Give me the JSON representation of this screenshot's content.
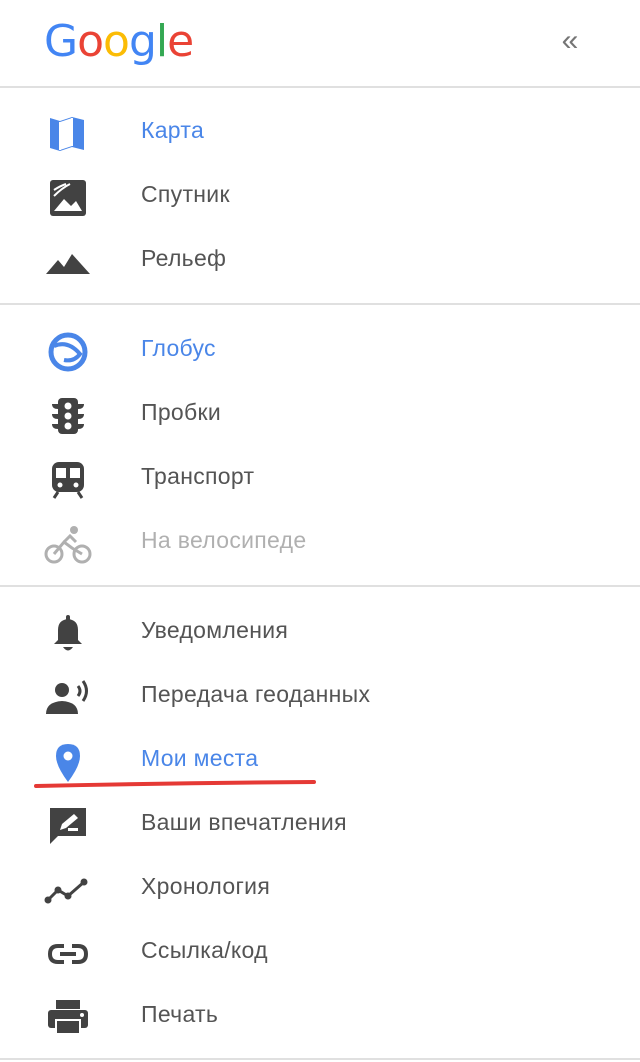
{
  "header": {
    "logo": {
      "letters": [
        {
          "ch": "G",
          "color": "#4285F4"
        },
        {
          "ch": "o",
          "color": "#EA4335"
        },
        {
          "ch": "o",
          "color": "#FBBC05"
        },
        {
          "ch": "g",
          "color": "#4285F4"
        },
        {
          "ch": "l",
          "color": "#34A853"
        },
        {
          "ch": "e",
          "color": "#EA4335"
        }
      ]
    },
    "collapse_glyph": "«",
    "collapse_icon": "double-chevron-left-icon"
  },
  "colors": {
    "accent": "#4a86e8",
    "text": "#545454",
    "disabled": "#b0b0b0",
    "icon": "#424242",
    "annotation": "#e53935"
  },
  "sections": [
    {
      "items": [
        {
          "label": "Карта",
          "icon": "map-icon",
          "state": "active"
        },
        {
          "label": "Спутник",
          "icon": "satellite-icon",
          "state": "normal"
        },
        {
          "label": "Рельеф",
          "icon": "terrain-icon",
          "state": "normal"
        }
      ]
    },
    {
      "items": [
        {
          "label": "Глобус",
          "icon": "globe-icon",
          "state": "active"
        },
        {
          "label": "Пробки",
          "icon": "traffic-light-icon",
          "state": "normal"
        },
        {
          "label": "Транспорт",
          "icon": "train-icon",
          "state": "normal"
        },
        {
          "label": "На велосипеде",
          "icon": "bike-icon",
          "state": "disabled"
        }
      ]
    },
    {
      "items": [
        {
          "label": "Уведомления",
          "icon": "bell-icon",
          "state": "normal"
        },
        {
          "label": "Передача геоданных",
          "icon": "location-sharing-icon",
          "state": "normal"
        },
        {
          "label": "Мои места",
          "icon": "place-pin-icon",
          "state": "active"
        },
        {
          "label": "Ваши впечатления",
          "icon": "feedback-icon",
          "state": "normal"
        },
        {
          "label": "Хронология",
          "icon": "timeline-icon",
          "state": "normal"
        },
        {
          "label": "Ссылка/код",
          "icon": "link-icon",
          "state": "normal"
        },
        {
          "label": "Печать",
          "icon": "print-icon",
          "state": "normal"
        }
      ]
    }
  ]
}
